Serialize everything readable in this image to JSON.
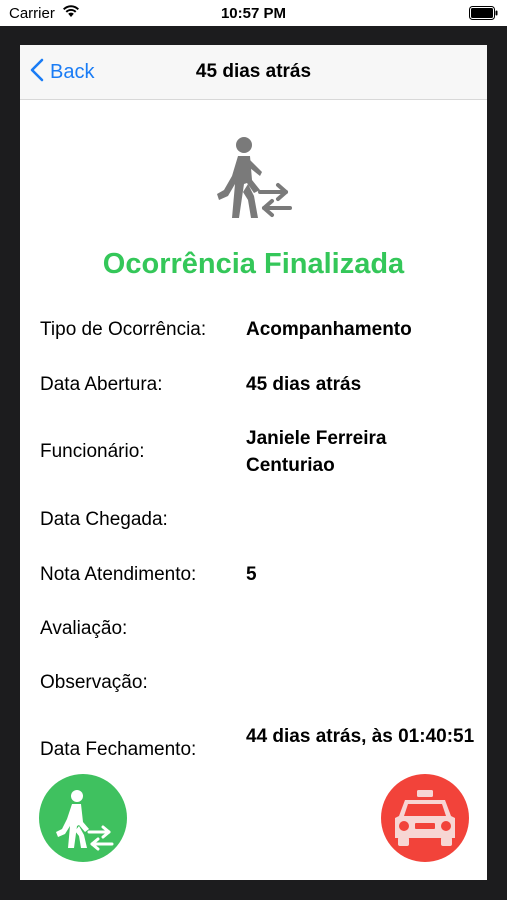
{
  "status_bar": {
    "carrier": "Carrier",
    "time": "10:57 PM"
  },
  "navbar": {
    "back_label": "Back",
    "title": "45 dias atrás"
  },
  "status_title": "Ocorrência Finalizada",
  "details": [
    {
      "label": "Tipo de Ocorrência:",
      "value": "Acompanhamento"
    },
    {
      "label": "Data Abertura:",
      "value": "45 dias atrás"
    },
    {
      "label": "Funcionário:",
      "value": "Janiele Ferreira Centuriao"
    },
    {
      "label": "Data Chegada:",
      "value": ""
    },
    {
      "label": "Nota Atendimento:",
      "value": "5"
    },
    {
      "label": "Avaliação:",
      "value": ""
    },
    {
      "label": "Observação:",
      "value": ""
    },
    {
      "label": "Data Fechamento:",
      "value": "44 dias atrás, às 01:40:51"
    }
  ],
  "icons": {
    "hero": "person-walking-transfer-icon",
    "left_button": "person-walking-transfer-icon",
    "right_button": "taxi-icon"
  },
  "colors": {
    "accent_blue": "#1a7cf5",
    "success_green": "#34c759",
    "fab_green": "#3fc15f",
    "fab_red": "#f2433a",
    "icon_gray": "#7a7a7a"
  }
}
